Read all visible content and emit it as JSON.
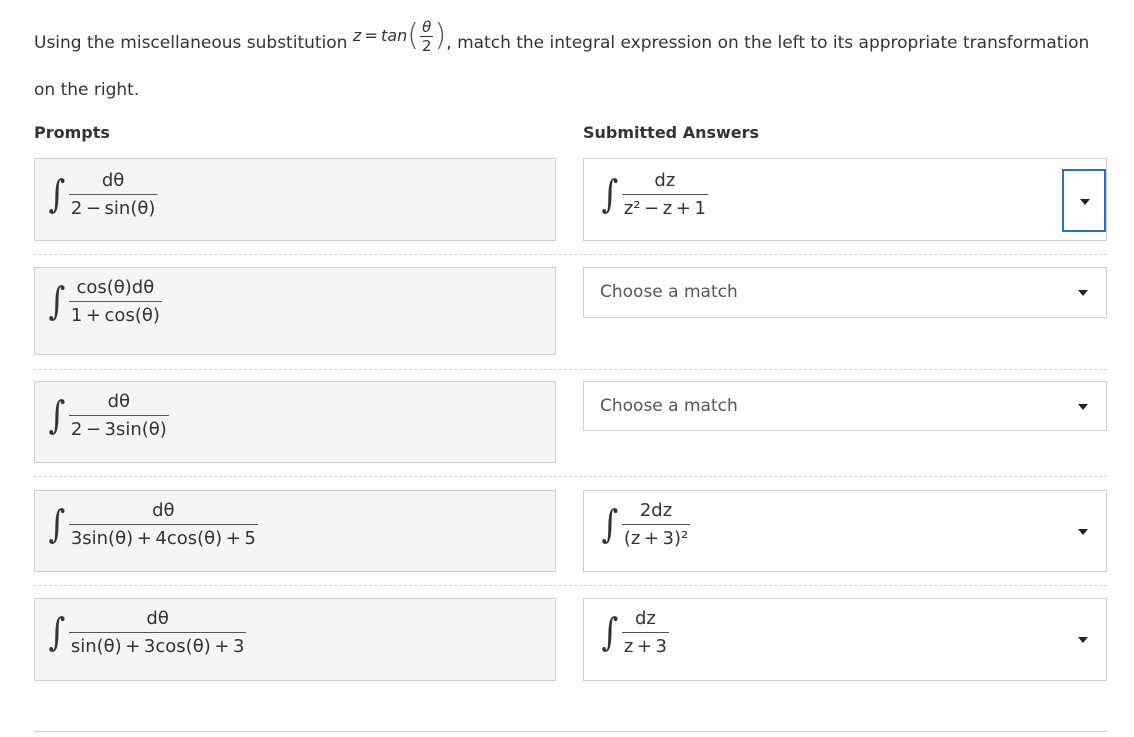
{
  "instruction": {
    "before": "Using the miscellaneous substitution",
    "math_lhs": "z = tan",
    "math_num": "θ",
    "math_den": "2",
    "after": ", match the integral expression on the left to its appropriate transformation on the right."
  },
  "headers": {
    "prompts": "Prompts",
    "answers": "Submitted Answers"
  },
  "integral_sign": "∫",
  "rows": [
    {
      "prompt": {
        "num": "dθ",
        "den": "2 − sin(θ)"
      },
      "answer": {
        "kind": "integral",
        "num": "dz",
        "den": "z² − z + 1"
      }
    },
    {
      "prompt": {
        "num": "cos(θ)dθ",
        "den": "1 + cos(θ)"
      },
      "answer": {
        "kind": "placeholder",
        "text": "Choose a match"
      }
    },
    {
      "prompt": {
        "num": "dθ",
        "den": "2 − 3sin(θ)"
      },
      "answer": {
        "kind": "placeholder",
        "text": "Choose a match"
      }
    },
    {
      "prompt": {
        "num": "dθ",
        "den": "3sin(θ) + 4cos(θ) + 5"
      },
      "answer": {
        "kind": "integral",
        "num": "2dz",
        "den": "(z + 3)²"
      }
    },
    {
      "prompt": {
        "num": "dθ",
        "den": "sin(θ) + 3cos(θ) + 3"
      },
      "answer": {
        "kind": "integral",
        "num": "dz",
        "den": "z + 3"
      }
    }
  ],
  "colors": {
    "focus": "#2f6fc3",
    "prompt_bg": "#f5f5f5",
    "border": "#cfcfcf"
  }
}
